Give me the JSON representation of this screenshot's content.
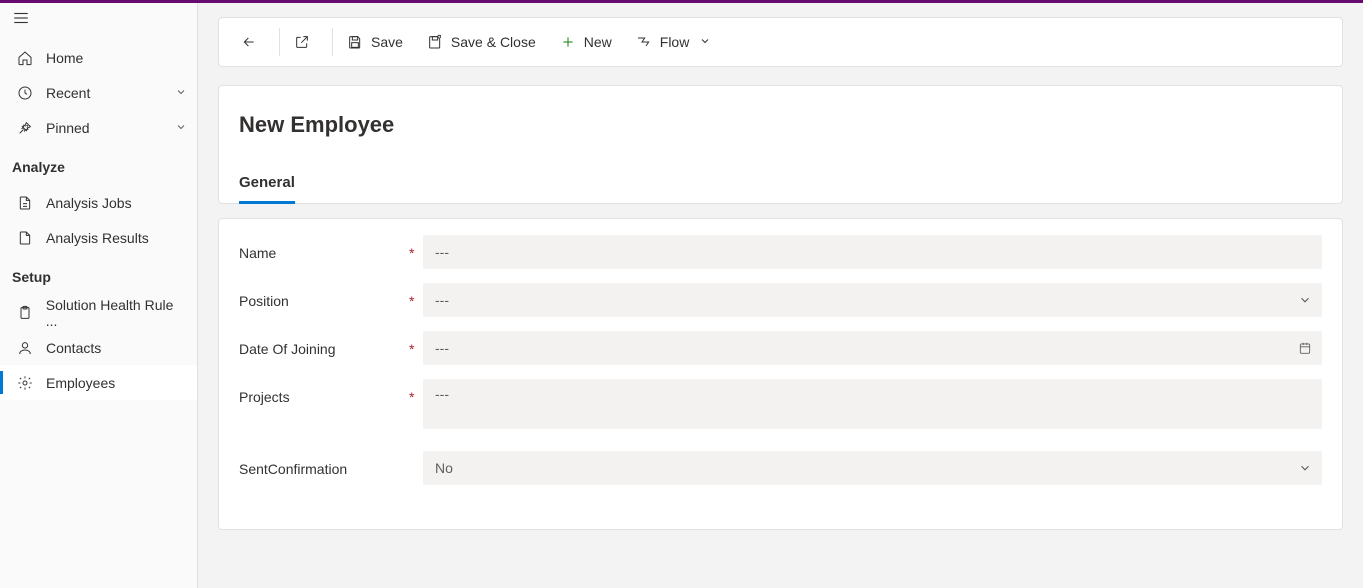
{
  "sidebar": {
    "home": "Home",
    "recent": "Recent",
    "pinned": "Pinned",
    "section_analyze": "Analyze",
    "analysis_jobs": "Analysis Jobs",
    "analysis_results": "Analysis Results",
    "section_setup": "Setup",
    "solution_health": "Solution Health Rule ...",
    "contacts": "Contacts",
    "employees": "Employees"
  },
  "cmd": {
    "save": "Save",
    "save_close": "Save & Close",
    "new": "New",
    "flow": "Flow"
  },
  "header": {
    "title": "New Employee",
    "tab_general": "General"
  },
  "form": {
    "name_label": "Name",
    "name_value": "---",
    "position_label": "Position",
    "position_value": "---",
    "doj_label": "Date Of Joining",
    "doj_value": "---",
    "projects_label": "Projects",
    "projects_value": "---",
    "sent_label": "SentConfirmation",
    "sent_value": "No"
  }
}
